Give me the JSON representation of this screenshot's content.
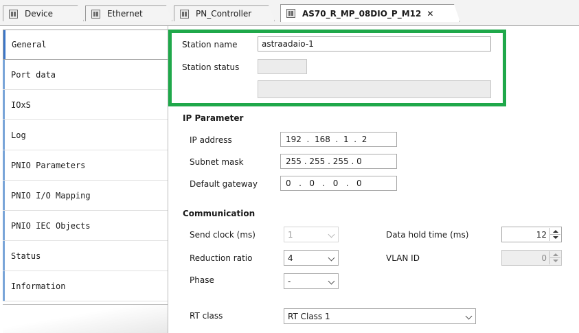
{
  "tabs": [
    {
      "label": "Device",
      "icon": "device-icon"
    },
    {
      "label": "Ethernet",
      "icon": "device-icon"
    },
    {
      "label": "PN_Controller",
      "icon": "device-icon"
    },
    {
      "label": "AS70_R_MP_08DIO_P_M12",
      "icon": "device-icon",
      "active": true,
      "close": "✕"
    }
  ],
  "nav": {
    "items": [
      {
        "label": "General",
        "selected": true
      },
      {
        "label": "Port data"
      },
      {
        "label": "IOxS"
      },
      {
        "label": "Log"
      },
      {
        "label": "PNIO Parameters"
      },
      {
        "label": "PNIO I/O Mapping"
      },
      {
        "label": "PNIO IEC Objects"
      },
      {
        "label": "Status"
      },
      {
        "label": "Information"
      }
    ]
  },
  "station": {
    "name_label": "Station name",
    "name_value": "astraadaio-1",
    "status_label": "Station status",
    "status_value": "",
    "status_text": "",
    "highlight_color": "#1fa84a"
  },
  "ip": {
    "title": "IP Parameter",
    "address_label": "IP address",
    "address": [
      "192",
      "168",
      "1",
      "2"
    ],
    "subnet_label": "Subnet mask",
    "subnet": [
      "255",
      "255",
      "255",
      "0"
    ],
    "gateway_label": "Default gateway",
    "gateway": [
      "0",
      "0",
      "0",
      "0"
    ]
  },
  "comm": {
    "title": "Communication",
    "send_clock_label": "Send clock (ms)",
    "send_clock_value": "1",
    "reduction_label": "Reduction ratio",
    "reduction_value": "4",
    "phase_label": "Phase",
    "phase_value": "-",
    "data_hold_label": "Data hold time (ms)",
    "data_hold_value": "12",
    "vlan_label": "VLAN ID",
    "vlan_value": "0",
    "rt_class_label": "RT class",
    "rt_class_value": "RT Class 1"
  }
}
